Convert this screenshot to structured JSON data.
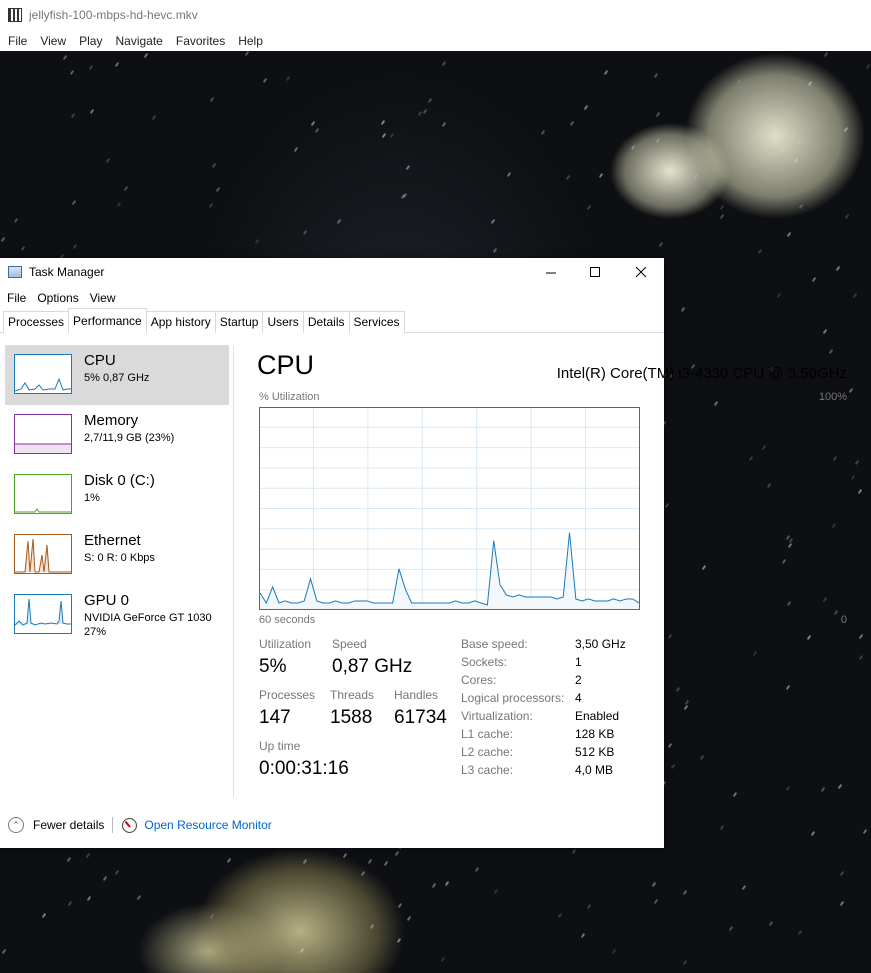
{
  "player": {
    "title": "jellyfish-100-mbps-hd-hevc.mkv",
    "menu": [
      "File",
      "View",
      "Play",
      "Navigate",
      "Favorites",
      "Help"
    ]
  },
  "taskmanager": {
    "title": "Task Manager",
    "menu": [
      "File",
      "Options",
      "View"
    ],
    "tabs": [
      "Processes",
      "Performance",
      "App history",
      "Startup",
      "Users",
      "Details",
      "Services"
    ],
    "active_tab": "Performance",
    "sidebar": [
      {
        "name": "CPU",
        "sub": "5% 0,87 GHz",
        "sub2": "",
        "color": "#1a7ab5"
      },
      {
        "name": "Memory",
        "sub": "2,7/11,9 GB (23%)",
        "sub2": "",
        "color": "#8b2ea0"
      },
      {
        "name": "Disk 0 (C:)",
        "sub": "1%",
        "sub2": "",
        "color": "#4da526"
      },
      {
        "name": "Ethernet",
        "sub": "S: 0 R: 0 Kbps",
        "sub2": "",
        "color": "#a6591b"
      },
      {
        "name": "GPU 0",
        "sub": "NVIDIA GeForce GT 1030",
        "sub2": "27%",
        "color": "#1a7ab5"
      }
    ],
    "main": {
      "heading": "CPU",
      "model": "Intel(R) Core(TM) i3-4330 CPU @ 3.50GHz",
      "util_label": "% Utilization",
      "util_max": "100%",
      "axis_left": "60 seconds",
      "axis_right": "0",
      "stats": {
        "utilization_label": "Utilization",
        "utilization": "5%",
        "speed_label": "Speed",
        "speed": "0,87 GHz",
        "processes_label": "Processes",
        "processes": "147",
        "threads_label": "Threads",
        "threads": "1588",
        "handles_label": "Handles",
        "handles": "61734",
        "uptime_label": "Up time",
        "uptime": "0:00:31:16"
      },
      "specs": [
        {
          "label": "Base speed:",
          "value": "3,50 GHz"
        },
        {
          "label": "Sockets:",
          "value": "1"
        },
        {
          "label": "Cores:",
          "value": "2"
        },
        {
          "label": "Logical processors:",
          "value": "4"
        },
        {
          "label": "Virtualization:",
          "value": "Enabled"
        },
        {
          "label": "L1 cache:",
          "value": "128 KB"
        },
        {
          "label": "L2 cache:",
          "value": "512 KB"
        },
        {
          "label": "L3 cache:",
          "value": "4,0 MB"
        }
      ]
    },
    "bottom": {
      "fewer_details": "Fewer details",
      "resource_monitor": "Open Resource Monitor"
    }
  },
  "chart_data": {
    "type": "area",
    "ylim": [
      0,
      100
    ],
    "xlim": [
      60,
      0
    ],
    "x": [
      60,
      59,
      58,
      57,
      56,
      55,
      54,
      53,
      52,
      51,
      50,
      49,
      48,
      47,
      46,
      45,
      44,
      43,
      42,
      41,
      40,
      39,
      38,
      37,
      36,
      35,
      34,
      33,
      32,
      31,
      30,
      29,
      28,
      27,
      26,
      25,
      24,
      23,
      22,
      21,
      20,
      19,
      18,
      17,
      16,
      15,
      14,
      13,
      12,
      11,
      10,
      9,
      8,
      7,
      6,
      5,
      4,
      3,
      2,
      1,
      0
    ],
    "values": [
      8,
      3,
      11,
      3,
      4,
      3,
      3,
      4,
      15,
      4,
      3,
      3,
      4,
      3,
      3,
      4,
      4,
      4,
      3,
      3,
      3,
      3,
      20,
      10,
      3,
      3,
      3,
      3,
      3,
      3,
      3,
      4,
      3,
      3,
      4,
      3,
      2,
      34,
      12,
      7,
      6,
      7,
      6,
      6,
      6,
      6,
      6,
      5,
      6,
      38,
      5,
      4,
      5,
      4,
      4,
      4,
      5,
      4,
      5,
      5,
      3
    ]
  }
}
